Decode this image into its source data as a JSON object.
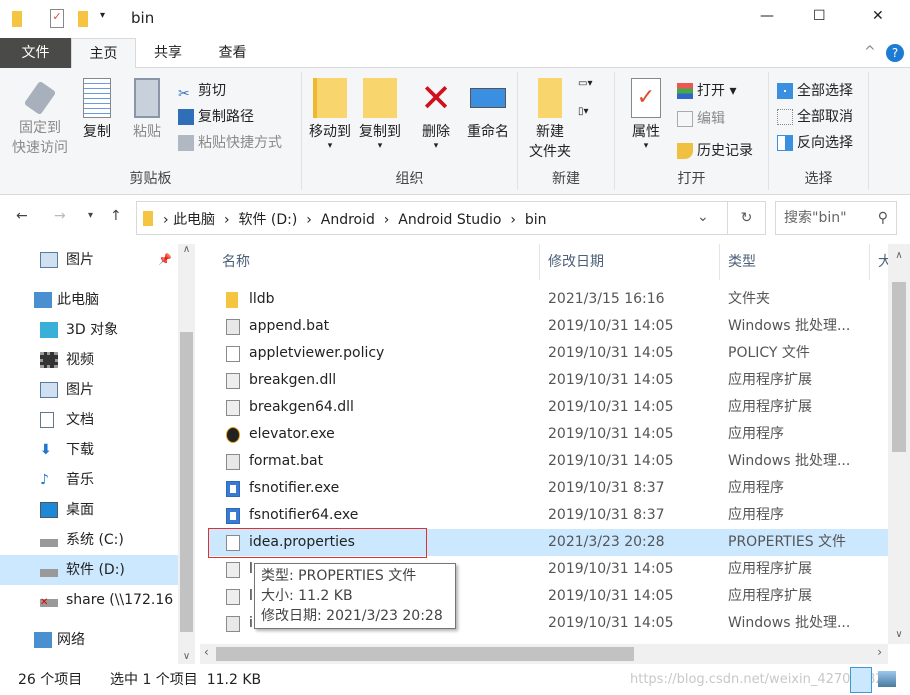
{
  "window": {
    "title": "bin",
    "minimize": "—",
    "maximize": "☐",
    "close": "✕"
  },
  "tabs": [
    {
      "label": "文件"
    },
    {
      "label": "主页"
    },
    {
      "label": "共享"
    },
    {
      "label": "查看"
    }
  ],
  "ribbon": {
    "clipboard": {
      "label": "剪贴板",
      "pin": "固定到",
      "pin2": "快速访问",
      "copy": "复制",
      "paste": "粘贴",
      "cut": "剪切",
      "copy_path": "复制路径",
      "paste_shortcut": "粘贴快捷方式"
    },
    "organize": {
      "label": "组织",
      "move_to": "移动到",
      "copy_to": "复制到",
      "delete": "删除",
      "rename": "重命名"
    },
    "new": {
      "label": "新建",
      "new_folder": "新建",
      "new_folder2": "文件夹"
    },
    "open": {
      "label": "打开",
      "properties": "属性",
      "open": "打开",
      "edit": "编辑",
      "history": "历史记录"
    },
    "select": {
      "label": "选择",
      "select_all": "全部选择",
      "select_none": "全部取消",
      "invert": "反向选择"
    }
  },
  "address": {
    "crumbs": [
      "此电脑",
      "软件 (D:)",
      "Android",
      "Android Studio",
      "bin"
    ],
    "search_placeholder": "搜索\"bin\""
  },
  "nav": [
    {
      "label": "图片"
    },
    {
      "label": "此电脑"
    },
    {
      "label": "3D 对象"
    },
    {
      "label": "视频"
    },
    {
      "label": "图片"
    },
    {
      "label": "文档"
    },
    {
      "label": "下载"
    },
    {
      "label": "音乐"
    },
    {
      "label": "桌面"
    },
    {
      "label": "系统 (C:)"
    },
    {
      "label": "软件 (D:)"
    },
    {
      "label": "share (\\\\172.16"
    },
    {
      "label": "网络"
    }
  ],
  "columns": {
    "name": "名称",
    "date": "修改日期",
    "type": "类型",
    "size": "大"
  },
  "files": [
    {
      "name": "lldb",
      "date": "2021/3/15 16:16",
      "type": "文件夹",
      "icon": "folder"
    },
    {
      "name": "append.bat",
      "date": "2019/10/31 14:05",
      "type": "Windows 批处理...",
      "icon": "bat"
    },
    {
      "name": "appletviewer.policy",
      "date": "2019/10/31 14:05",
      "type": "POLICY 文件",
      "icon": "file"
    },
    {
      "name": "breakgen.dll",
      "date": "2019/10/31 14:05",
      "type": "应用程序扩展",
      "icon": "dll"
    },
    {
      "name": "breakgen64.dll",
      "date": "2019/10/31 14:05",
      "type": "应用程序扩展",
      "icon": "dll"
    },
    {
      "name": "elevator.exe",
      "date": "2019/10/31 14:05",
      "type": "应用程序",
      "icon": "exe-elevator"
    },
    {
      "name": "format.bat",
      "date": "2019/10/31 14:05",
      "type": "Windows 批处理...",
      "icon": "bat"
    },
    {
      "name": "fsnotifier.exe",
      "date": "2019/10/31 8:37",
      "type": "应用程序",
      "icon": "exe"
    },
    {
      "name": "fsnotifier64.exe",
      "date": "2019/10/31 8:37",
      "type": "应用程序",
      "icon": "exe"
    },
    {
      "name": "idea.properties",
      "date": "2021/3/23 20:28",
      "type": "PROPERTIES 文件",
      "icon": "file",
      "selected": true
    },
    {
      "name": "l",
      "date": "2019/10/31 14:05",
      "type": "应用程序扩展",
      "icon": "dll"
    },
    {
      "name": "l",
      "date": "2019/10/31 14:05",
      "type": "应用程序扩展",
      "icon": "dll"
    },
    {
      "name": "i",
      "date": "2019/10/31 14:05",
      "type": "Windows 批处理...",
      "icon": "bat"
    }
  ],
  "tooltip": {
    "type": "类型: PROPERTIES 文件",
    "size": "大小: 11.2 KB",
    "modified": "修改日期: 2021/3/23 20:28"
  },
  "status": {
    "count": "26 个项目",
    "selected": "选中 1 个项目  11.2 KB"
  },
  "watermark": "https://blog.csdn.net/weixin_42708382"
}
